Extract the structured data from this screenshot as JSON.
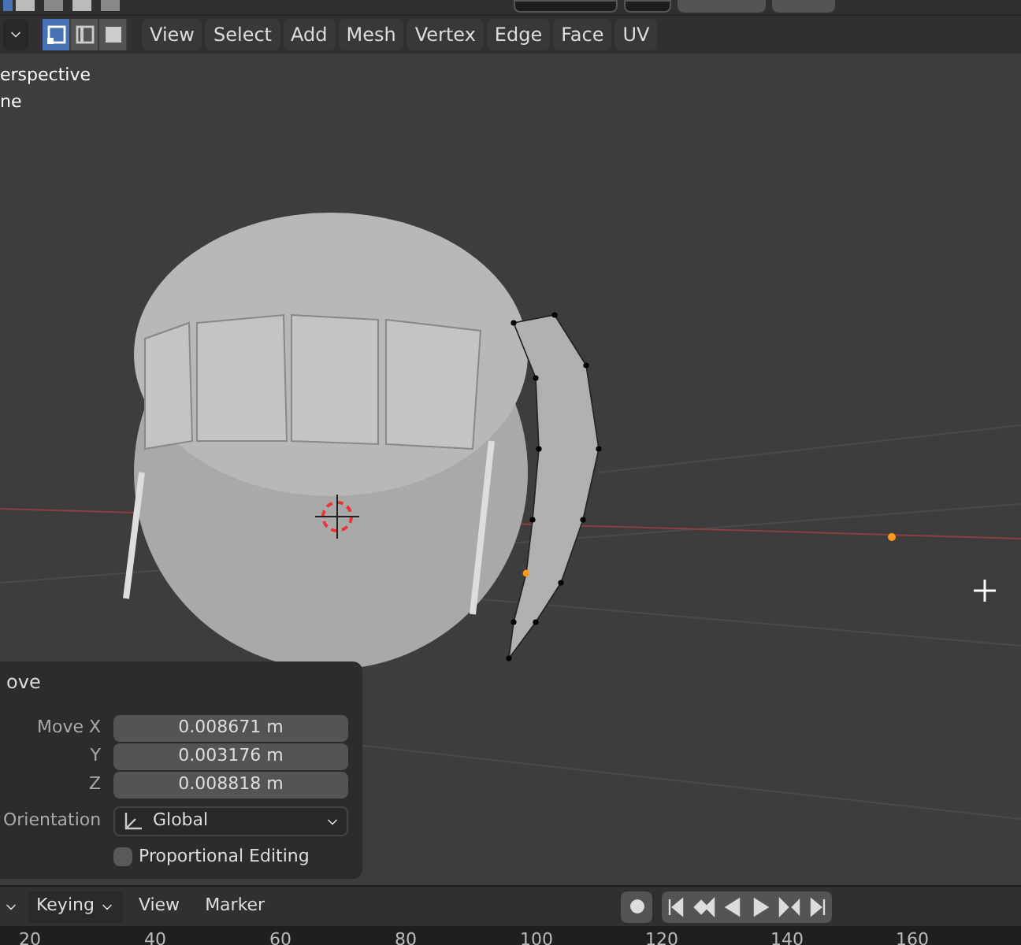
{
  "header": {
    "select_modes": [
      {
        "kind": "vertex",
        "selected": true
      },
      {
        "kind": "edge",
        "selected": false
      },
      {
        "kind": "face",
        "selected": false
      }
    ],
    "menus": [
      "View",
      "Select",
      "Add",
      "Mesh",
      "Vertex",
      "Edge",
      "Face",
      "UV"
    ]
  },
  "viewport": {
    "overlay_lines": [
      "erspective",
      "ne"
    ]
  },
  "operator_panel": {
    "title": "ove",
    "fields": [
      {
        "label": "Move X",
        "value": "0.008671 m"
      },
      {
        "label": "Y",
        "value": "0.003176 m"
      },
      {
        "label": "Z",
        "value": "0.008818 m"
      }
    ],
    "orientation": {
      "label": "Orientation",
      "value": "Global"
    },
    "proportional_editing": {
      "label": "Proportional Editing",
      "checked": false
    }
  },
  "timeline": {
    "keying": "Keying",
    "menus": [
      "View",
      "Marker"
    ],
    "record": {
      "on": false
    },
    "ticks": [
      "20",
      "40",
      "60",
      "80",
      "100",
      "120",
      "140",
      "160"
    ]
  }
}
